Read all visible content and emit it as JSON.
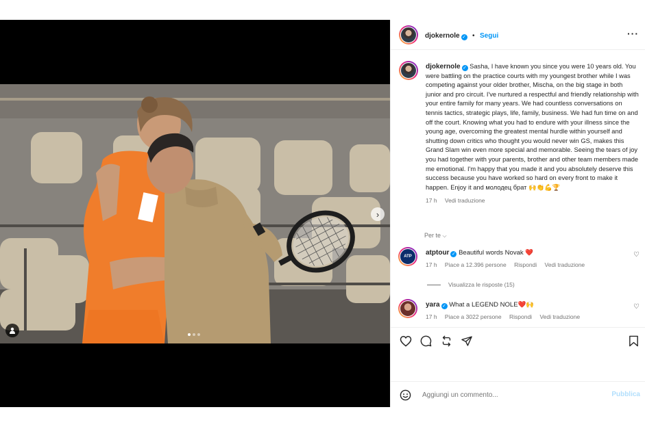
{
  "post": {
    "username": "djokernole",
    "follow_label": "Segui",
    "separator": "•",
    "caption_user": "djokernole",
    "caption": "Sasha, I have known you since you were 10 years old. You were battling on the practice courts with my youngest brother while I was competing against your older brother, Mischa, on the big stage in both junior and pro circuit. I've nurtured a respectful and friendly relationship with your entire family for many years. We had countless conversations on tennis tactics, strategic plays, life, family, business. We had fun time on and off the court. Knowing what you had to endure with your illness since the young age, overcoming the greatest mental hurdle within yourself and shutting down critics who thought you would never win GS, makes this Grand Slam win even more special and memorable. Seeing the tears of joy you had together with your parents, brother and other team members made me emotional. I'm happy that you made it and you absolutely deserve this success because you have worked so hard on every front to make it happen. Enjoy it and молодец брат 🙌👏💪🏆",
    "time": "17 h",
    "translate_label": "Vedi traduzione",
    "for_you_label": "Per te"
  },
  "comments": [
    {
      "user": "atptour",
      "text": "Beautiful words Novak ❤️",
      "time": "17 h",
      "likes": "Piace a 12.396 persone",
      "reply": "Rispondi",
      "translate": "Vedi traduzione",
      "view_replies": "Visualizza le risposte (15)",
      "avatar_text": "ATP"
    },
    {
      "user": "yara",
      "text": "What a LEGEND NOLE❤️🙌",
      "time": "17 h",
      "likes": "Piace a 3022 persone",
      "reply": "Rispondi",
      "translate": "Vedi traduzione"
    }
  ],
  "add_comment": {
    "placeholder": "Aggiungi un commento...",
    "publish_label": "Pubblica"
  },
  "colors": {
    "accent": "#0095f6",
    "player_orange": "#f07d2b"
  },
  "icons": [
    "heart-icon",
    "comment-icon",
    "repost-icon",
    "share-icon",
    "bookmark-icon",
    "emoji-icon",
    "more-icon",
    "chevron-right-icon",
    "person-tag-icon",
    "verified-icon"
  ]
}
